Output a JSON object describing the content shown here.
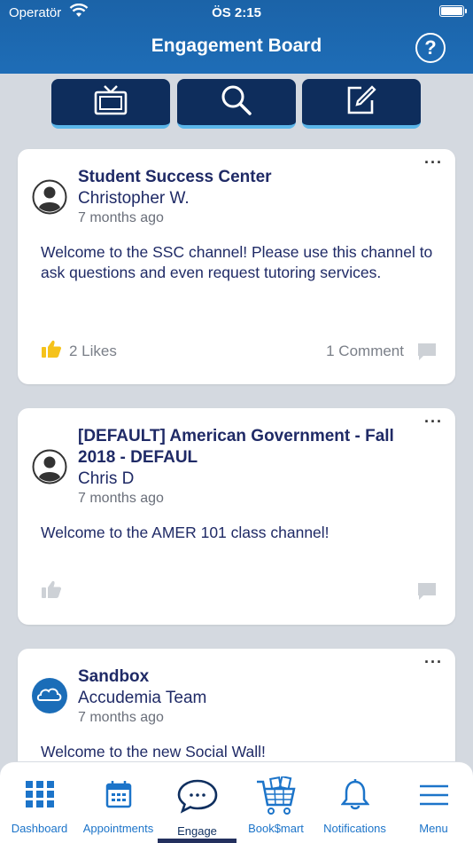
{
  "status_bar": {
    "carrier": "Operatör",
    "time": "ÖS 2:15"
  },
  "header": {
    "title": "Engagement Board"
  },
  "toolbar": {
    "buttons": [
      "tv-icon",
      "search-icon",
      "compose-icon"
    ]
  },
  "posts": [
    {
      "channel": "Student Success Center",
      "author": "Christopher W.",
      "time": "7 months ago",
      "message": "Welcome to the SSC channel! Please use this channel to ask questions and even request tutoring services.",
      "likes": "2 Likes",
      "comments": "1 Comment"
    },
    {
      "channel": "[DEFAULT] American Government - Fall 2018 - DEFAUL",
      "author": "Chris D",
      "time": "7 months ago",
      "message": "Welcome to the AMER 101 class channel!"
    },
    {
      "channel": "Sandbox",
      "author": "Accudemia Team",
      "time": "7 months ago",
      "message": "Welcome to the new Social Wall!"
    }
  ],
  "tabbar": {
    "tabs": [
      {
        "label": "Dashboard",
        "icon": "grid-icon"
      },
      {
        "label": "Appointments",
        "icon": "calendar-icon"
      },
      {
        "label": "Engage",
        "icon": "chat-bubble-icon",
        "active": true
      },
      {
        "label": "Book$mart",
        "icon": "cart-icon"
      },
      {
        "label": "Notifications",
        "icon": "bell-icon"
      },
      {
        "label": "Menu",
        "icon": "hamburger-icon"
      }
    ]
  },
  "colors": {
    "header": "#1e6db7",
    "toolbar": "#0e2d5c",
    "accent": "#1c74c9",
    "like_active": "#f5c21b"
  }
}
